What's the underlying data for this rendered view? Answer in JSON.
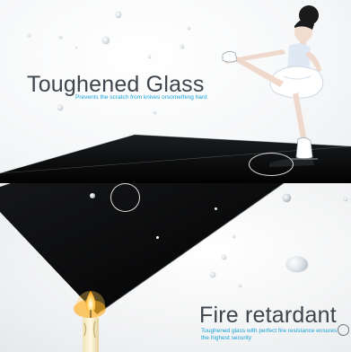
{
  "sections": {
    "toughened": {
      "title": "Toughened Glass",
      "subtitle": "Prevents the scratch from knives orsomething hard"
    },
    "fire": {
      "title": "Fire retardant",
      "subtitle": "Toughened glass with perfect fire resistance ensures the highest  security"
    }
  },
  "colors": {
    "title": "#3e454c",
    "subtitle_accent": "#1aa2d8",
    "glass": "#050505",
    "flame": "#ffb300"
  },
  "icons": {
    "illustration_top": "figure-skater-illustration",
    "illustration_bottom": "candle-flame-illustration"
  }
}
